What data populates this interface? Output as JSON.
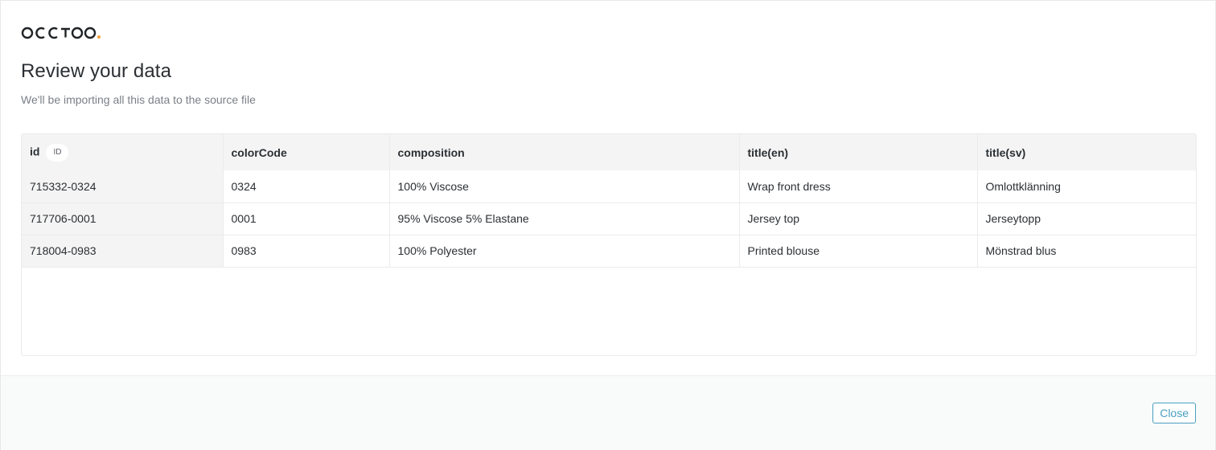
{
  "brand": {
    "logo_icon": "occtoo-logo-icon",
    "accent": "#f2a33a"
  },
  "header": {
    "title": "Review your data",
    "subtitle": "We'll be importing all this data to the source file"
  },
  "table": {
    "columns": [
      "id",
      "colorCode",
      "composition",
      "title(en)",
      "title(sv)"
    ],
    "id_badge": "ID",
    "rows": [
      [
        "715332-0324",
        "0324",
        "100% Viscose",
        "Wrap front dress",
        "Omlottklänning"
      ],
      [
        "717706-0001",
        "0001",
        "95% Viscose 5% Elastane",
        "Jersey top",
        "Jerseytopp"
      ],
      [
        "718004-0983",
        "0983",
        "100% Polyester",
        "Printed blouse",
        "Mönstrad blus"
      ]
    ]
  },
  "footer": {
    "close_label": "Close",
    "accent": "#4a9fc0"
  }
}
